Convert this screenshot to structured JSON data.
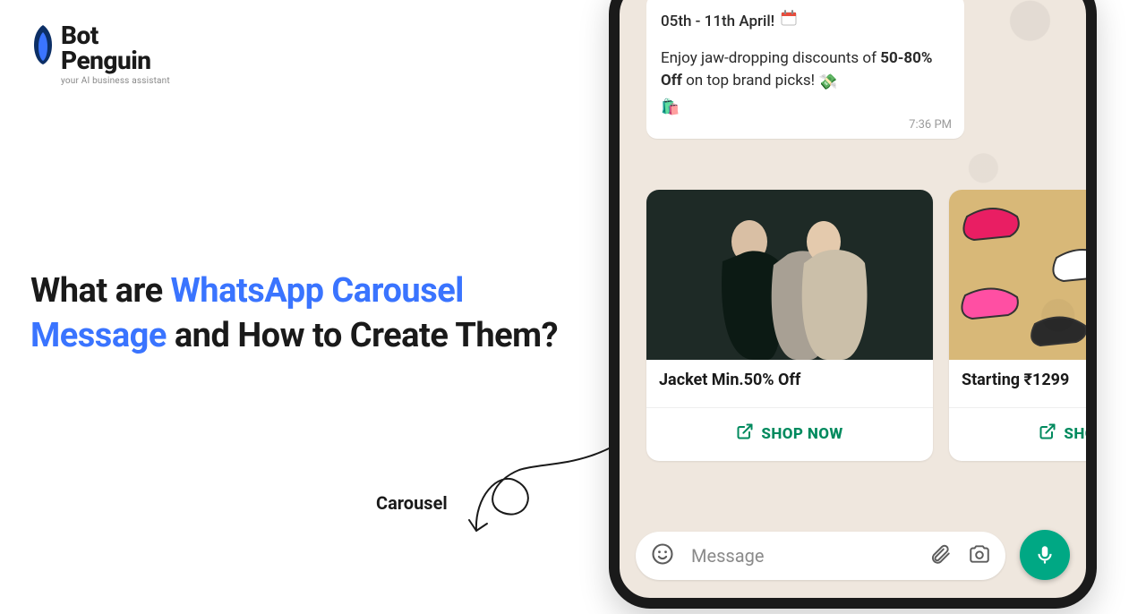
{
  "logo": {
    "brand_top": "Bot",
    "brand_bottom": "Penguin",
    "tagline": "your AI business assistant"
  },
  "headline": {
    "prefix": "What are ",
    "accent": "WhatsApp Carousel Message",
    "suffix": " and How to Create Them?"
  },
  "annotation": {
    "label": "Carousel"
  },
  "chat": {
    "bubble_line1": "05th - 11th April!",
    "bubble_line2_a": "Enjoy jaw-dropping discounts of ",
    "bubble_discount": "50-80% Off",
    "bubble_line2_b": " on top brand picks! ",
    "timestamp": "7:36 PM"
  },
  "carousel": {
    "cards": [
      {
        "title": "Jacket Min.50% Off",
        "action": "SHOP NOW"
      },
      {
        "title": "Starting ₹1299",
        "action": "SHOP NOW"
      }
    ]
  },
  "inputbar": {
    "placeholder": "Message"
  },
  "colors": {
    "accent_blue": "#3a74ff",
    "whatsapp_green": "#00a884",
    "action_green": "#008a5e"
  }
}
